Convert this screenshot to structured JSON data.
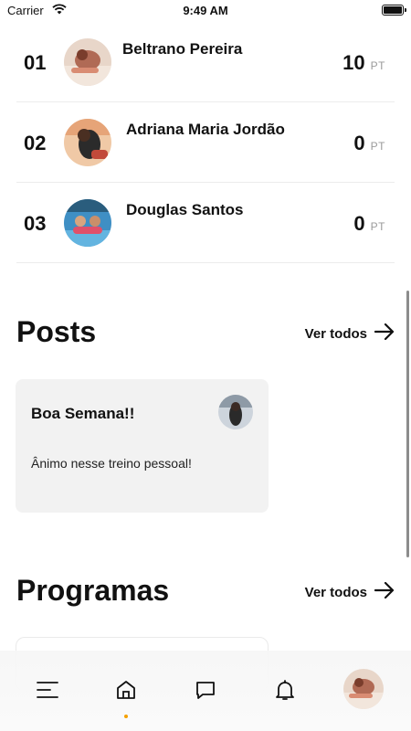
{
  "status_bar": {
    "carrier": "Carrier",
    "time": "9:49 AM"
  },
  "ranking": [
    {
      "position": "01",
      "name": "Beltrano Pereira",
      "score": "10",
      "unit": "PT"
    },
    {
      "position": "02",
      "name": "Adriana Maria Jordão",
      "score": "0",
      "unit": "PT"
    },
    {
      "position": "03",
      "name": "Douglas Santos",
      "score": "0",
      "unit": "PT"
    }
  ],
  "posts": {
    "title": "Posts",
    "see_all": "Ver todos",
    "items": [
      {
        "title": "Boa Semana!!",
        "body": "Ânimo nesse treino pessoal!"
      }
    ]
  },
  "programs": {
    "title": "Programas",
    "see_all": "Ver todos"
  },
  "bottom_nav": {
    "items": [
      "menu-icon",
      "home-icon",
      "chat-icon",
      "bell-icon",
      "profile-avatar"
    ],
    "active": "home-icon",
    "accent": "#f5a000"
  }
}
